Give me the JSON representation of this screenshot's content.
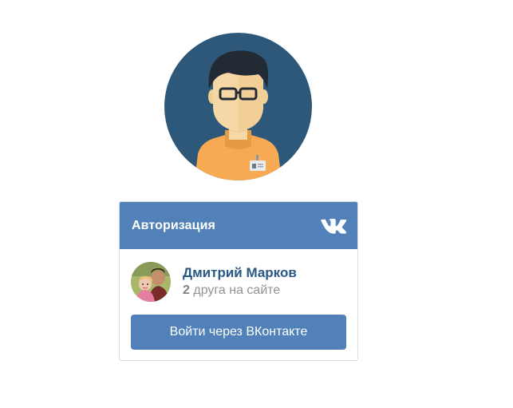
{
  "profile_avatar": {
    "icon": "user-with-glasses-avatar-icon",
    "background_color": "#2e5879"
  },
  "widget": {
    "title": "Авторизация",
    "logo_icon": "vk-logo-icon",
    "header_color": "#5181b8",
    "user": {
      "name": "Дмитрий Марков",
      "friends_count": "2",
      "friends_text": "друга на сайте",
      "photo_icon": "user-photo-icon"
    },
    "login_button_label": "Войти через ВКонтакте",
    "button_color": "#5181b8"
  }
}
